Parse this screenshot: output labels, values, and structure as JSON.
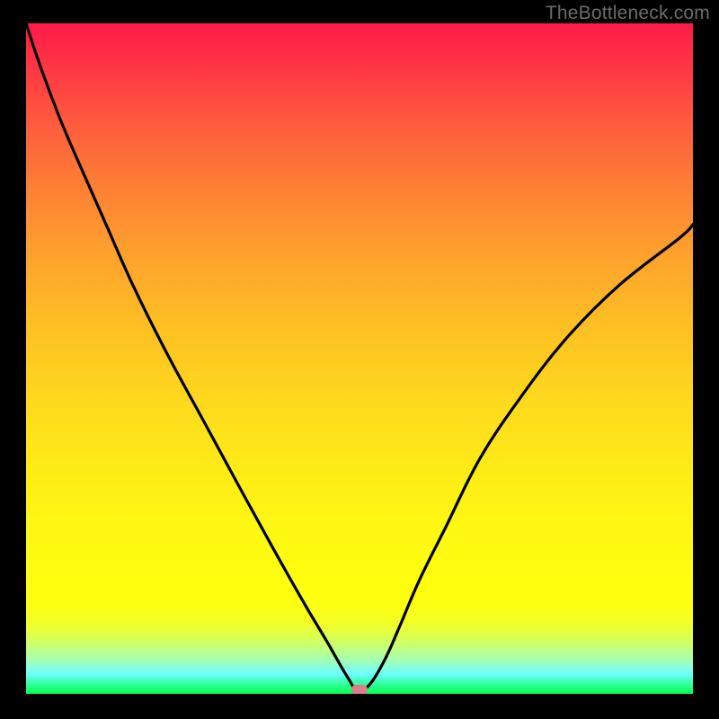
{
  "watermark": "TheBottleneck.com",
  "chart_data": {
    "type": "line",
    "title": "",
    "xlabel": "",
    "ylabel": "",
    "xlim": [
      0,
      100
    ],
    "ylim": [
      0,
      100
    ],
    "grid": false,
    "legend": false,
    "background": "vertical-gradient red→yellow→green (bottleneck heatmap)",
    "series": [
      {
        "name": "bottleneck-curve",
        "color": "#000000",
        "x": [
          0,
          2,
          5,
          8,
          12,
          16,
          21,
          27,
          33,
          38,
          42,
          45,
          47,
          48.5,
          49.5,
          50.5,
          52,
          54,
          56,
          59,
          63,
          68,
          74,
          81,
          89,
          98,
          100
        ],
        "y": [
          100,
          94,
          86,
          79,
          70,
          61,
          51,
          40,
          29,
          20,
          13,
          8,
          4.5,
          2,
          0.5,
          0.5,
          2,
          5.5,
          10,
          17,
          25,
          35,
          44,
          53,
          61,
          68,
          70
        ]
      }
    ],
    "marker": {
      "name": "optimal-point",
      "x": 50,
      "y": 0.5,
      "color": "#d97f8a"
    }
  }
}
